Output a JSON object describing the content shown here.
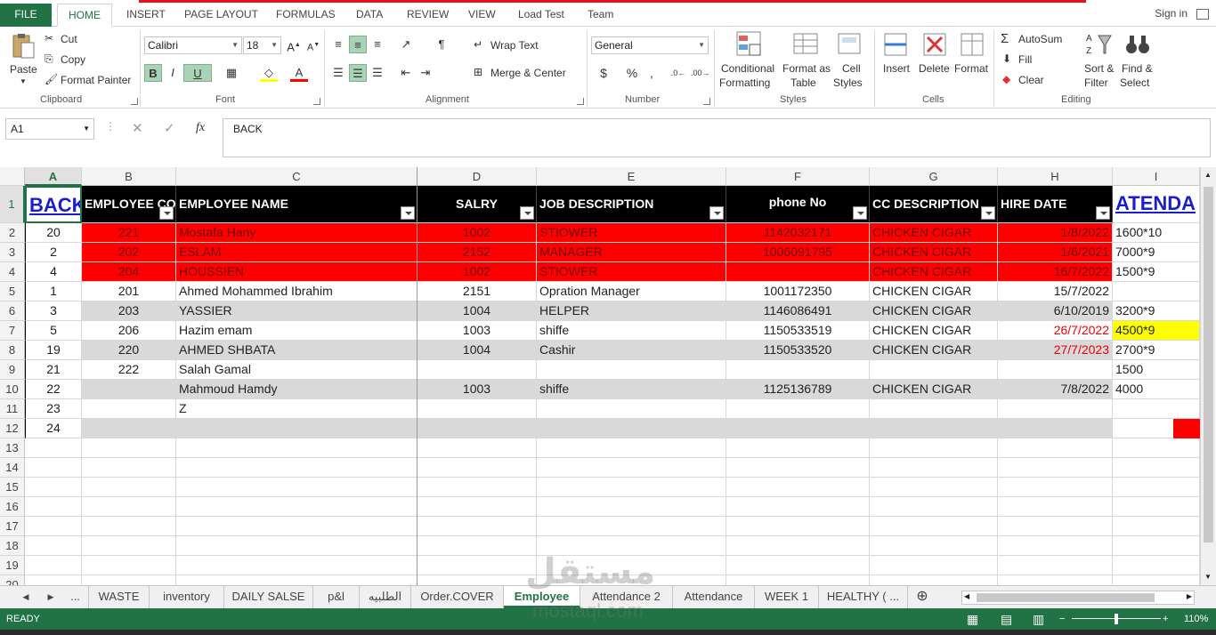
{
  "ribbon_tabs": [
    "FILE",
    "HOME",
    "INSERT",
    "PAGE LAYOUT",
    "FORMULAS",
    "DATA",
    "REVIEW",
    "VIEW",
    "Load Test",
    "Team"
  ],
  "sign_in": "Sign in",
  "clipboard": {
    "paste": "Paste",
    "cut": "Cut",
    "copy": "Copy",
    "format_painter": "Format Painter",
    "label": "Clipboard"
  },
  "font": {
    "name": "Calibri",
    "size": "18",
    "bold": "B",
    "italic": "I",
    "underline": "U",
    "label": "Font"
  },
  "alignment": {
    "wrap": "Wrap Text",
    "merge": "Merge & Center",
    "label": "Alignment"
  },
  "number": {
    "format": "General",
    "currency": "$",
    "percent": "%",
    "comma": ",",
    "label": "Number"
  },
  "styles": {
    "conditional": "Conditional",
    "conditional2": "Formatting",
    "format_table": "Format as",
    "format_table2": "Table",
    "cell_styles": "Cell",
    "cell_styles2": "Styles",
    "label": "Styles"
  },
  "cells": {
    "insert": "Insert",
    "delete": "Delete",
    "format": "Format",
    "label": "Cells"
  },
  "editing": {
    "autosum": "AutoSum",
    "fill": "Fill",
    "clear": "Clear",
    "sort": "Sort &",
    "sort2": "Filter",
    "find": "Find &",
    "find2": "Select",
    "label": "Editing"
  },
  "formula_bar": {
    "name_box": "A1",
    "fx": "fx",
    "content": "BACK"
  },
  "columns": [
    "A",
    "B",
    "C",
    "D",
    "E",
    "F",
    "G",
    "H",
    "I"
  ],
  "header_row": {
    "a": "BACK",
    "b": "EMPLOYEE CODE",
    "c": "EMPLOYEE NAME",
    "d": "SALRY",
    "e": "JOB DESCRIPTION",
    "f": "phone No",
    "g": "CC DESCRIPTION",
    "h": "HIRE DATE",
    "i": "ATENDA"
  },
  "rows": [
    {
      "n": "2",
      "a": "20",
      "b": "221",
      "c": "Mostafa Hany",
      "d": "1002",
      "e": "STIOWER",
      "f": "1142032171",
      "g": "CHICKEN CIGAR",
      "h": "1/8/2022",
      "i": "1600*10",
      "style": "red"
    },
    {
      "n": "3",
      "a": "2",
      "b": "202",
      "c": "ESLAM",
      "d": "2152",
      "e": "MANAGER",
      "f": "1006091795",
      "g": "CHICKEN CIGAR",
      "h": "1/6/2021",
      "i": "7000*9",
      "style": "red"
    },
    {
      "n": "4",
      "a": "4",
      "b": "204",
      "c": "HOUSSIEN",
      "d": "1002",
      "e": "STIOWER",
      "f": "",
      "g": "CHICKEN CIGAR",
      "h": "16/7/2022",
      "i": "1500*9",
      "style": "red"
    },
    {
      "n": "5",
      "a": "1",
      "b": "201",
      "c": "Ahmed Mohammed Ibrahim",
      "d": "2151",
      "e": "Opration Manager",
      "f": "1001172350",
      "g": "CHICKEN CIGAR",
      "h": "15/7/2022",
      "i": "",
      "style": "white"
    },
    {
      "n": "6",
      "a": "3",
      "b": "203",
      "c": "YASSIER",
      "d": "1004",
      "e": "HELPER",
      "f": "1146086491",
      "g": "CHICKEN CIGAR",
      "h": "6/10/2019",
      "i": "3200*9",
      "style": "gray"
    },
    {
      "n": "7",
      "a": "5",
      "b": "206",
      "c": "Hazim emam",
      "d": "1003",
      "e": "shiffe",
      "f": "1150533519",
      "g": "CHICKEN CIGAR",
      "h": "26/7/2022",
      "i": "4500*9",
      "style": "white",
      "h_red": true,
      "i_yellow": true
    },
    {
      "n": "8",
      "a": "19",
      "b": "220",
      "c": "AHMED SHBATA",
      "d": "1004",
      "e": "Cashir",
      "f": "1150533520",
      "g": "CHICKEN CIGAR",
      "h": "27/7/2023",
      "i": "2700*9",
      "style": "gray",
      "h_red": true
    },
    {
      "n": "9",
      "a": "21",
      "b": "222",
      "c": "Salah Gamal",
      "d": "",
      "e": "",
      "f": "",
      "g": "",
      "h": "",
      "i": "1500",
      "style": "white"
    },
    {
      "n": "10",
      "a": "22",
      "b": "",
      "c": "Mahmoud Hamdy",
      "d": "1003",
      "e": "shiffe",
      "f": "1125136789",
      "g": "CHICKEN CIGAR",
      "h": "7/8/2022",
      "i": "4000",
      "style": "gray"
    },
    {
      "n": "11",
      "a": "23",
      "b": "",
      "c": "Z",
      "d": "",
      "e": "",
      "f": "",
      "g": "",
      "h": "",
      "i": "",
      "style": "white"
    },
    {
      "n": "12",
      "a": "24",
      "b": "",
      "c": "",
      "d": "",
      "e": "",
      "f": "",
      "g": "",
      "h": "",
      "i": "",
      "style": "gray"
    }
  ],
  "empty_rows": [
    "13",
    "14",
    "15",
    "16",
    "17",
    "18",
    "19",
    "20"
  ],
  "sheet_tabs": [
    "...",
    "WASTE",
    "inventory",
    "DAILY SALSE",
    "p&l",
    "الطلبيه",
    "Order.COVER",
    "Employee",
    "Attendance 2",
    "Attendance",
    "WEEK 1",
    "HEALTHY ( ..."
  ],
  "active_sheet": "Employee",
  "status": {
    "ready": "READY",
    "zoom": "110%"
  },
  "watermark": {
    "ar": "مستقل",
    "en": "mostaql.com"
  }
}
